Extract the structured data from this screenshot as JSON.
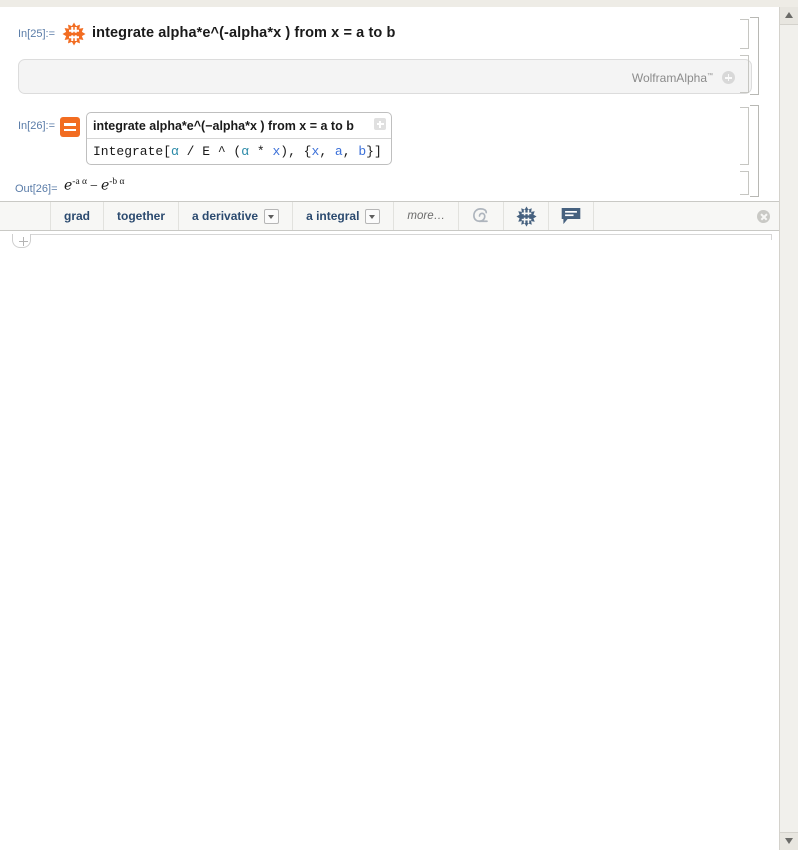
{
  "window": {
    "top_toolbar_hint": ""
  },
  "cells": {
    "wa_query": {
      "label": "In[25]:=",
      "icon": "wolfram-alpha-spikey-icon",
      "text": "integrate alpha*e^(-alpha*x ) from x = a to b"
    },
    "wa_pod": {
      "brand": "WolframAlpha",
      "trademark": "™",
      "plus_icon": "plus-circle-icon"
    },
    "wa_input": {
      "label": "In[26]:=",
      "icon": "equals-badge-icon",
      "query_line": "integrate alpha*e^(−alpha*x ) from x = a to b",
      "code": {
        "fn": "Integrate[",
        "alpha1": "α",
        "slash": " / E ^ (",
        "alpha2": "α",
        "star": " * ",
        "x1": "x",
        "close1": "),  {",
        "x2": "x",
        "comma1": ",  ",
        "a": "a",
        "comma2": ",  ",
        "b": "b",
        "close2": "}]"
      },
      "plus_button": "plus-button"
    },
    "output": {
      "label": "Out[26]=",
      "base1": "ℯ",
      "exp1": "-a α",
      "operator": "−",
      "base2": "ℯ",
      "exp2": "-b α",
      "full_text": "ℯ^(-a α) − ℯ^(-b α)"
    }
  },
  "suggestions_bar": {
    "buttons": [
      {
        "label": "grad",
        "has_caret": false
      },
      {
        "label": "together",
        "has_caret": false
      },
      {
        "label": "a derivative",
        "has_caret": true
      },
      {
        "label": "a integral",
        "has_caret": true
      },
      {
        "label": "more…",
        "has_caret": false,
        "style": "more"
      }
    ],
    "icon_buttons": [
      {
        "name": "mathematica-spikey-e-icon"
      },
      {
        "name": "wolfram-alpha-spikey-icon"
      },
      {
        "name": "comment-bubble-icon"
      }
    ],
    "close_icon": "close-icon"
  },
  "insertion_point": {
    "plus_icon": "plus-icon"
  },
  "scrollbar": {
    "up_arrow": "scroll-up-arrow",
    "down_arrow": "scroll-down-arrow"
  },
  "colors": {
    "accent_orange": "#f26c21",
    "label_blue": "#5a7ca8",
    "suggestion_text": "#2b4a6f",
    "code_symbol_blue": "#3a6fd8",
    "code_greek_teal": "#2b8aa8"
  }
}
